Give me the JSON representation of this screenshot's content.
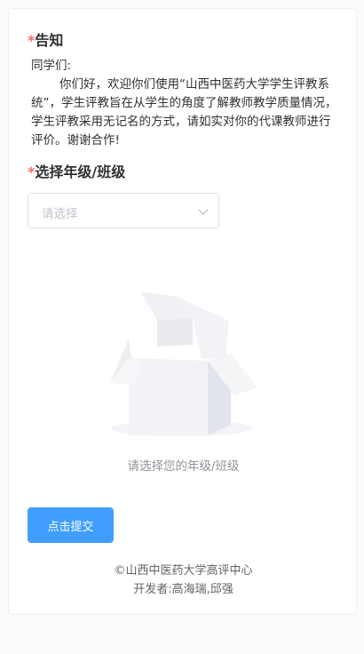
{
  "notice": {
    "required_mark": "*",
    "title": "告知",
    "greeting": "同学们:",
    "body": "你们好，欢迎你们使用“山西中医药大学学生评教系统”，学生评教旨在从学生的角度了解教师教学质量情况，学生评教采用无记名的方式，请如实对你的代课教师进行评价。谢谢合作!"
  },
  "grade_select": {
    "required_mark": "*",
    "title": "选择年级/班级",
    "placeholder": "请选择",
    "arrow_icon": "chevron-down-icon"
  },
  "empty_state": {
    "icon": "empty-box-icon",
    "text": "请选择您的年级/班级"
  },
  "submit_button": {
    "label": "点击提交",
    "color": "#409eff"
  },
  "footer": {
    "copyright": "©山西中医药大学高评中心",
    "developers": "开发者:高海瑞,邱强"
  },
  "colors": {
    "required": "#f56c6c",
    "placeholder": "#c0c4cc",
    "muted_text": "#909399"
  }
}
